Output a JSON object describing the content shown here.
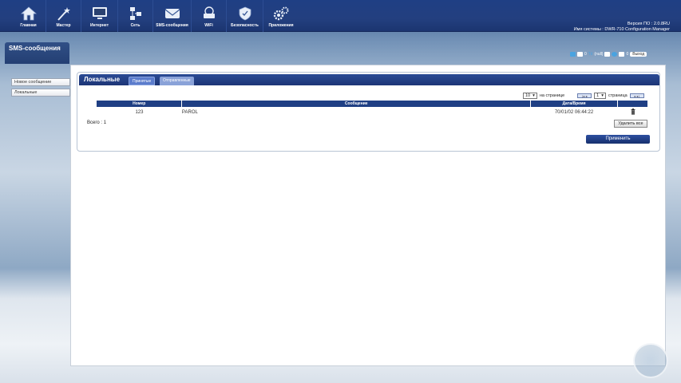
{
  "nav": {
    "items": [
      {
        "label": "Главная",
        "icon": "home-icon"
      },
      {
        "label": "Мастер",
        "icon": "wizard-icon"
      },
      {
        "label": "Интернет",
        "icon": "monitor-icon"
      },
      {
        "label": "Сеть",
        "icon": "network-icon"
      },
      {
        "label": "SMS-сообщения",
        "icon": "envelope-icon"
      },
      {
        "label": "WiFi",
        "icon": "wifi-router-icon"
      },
      {
        "label": "Безопасность",
        "icon": "shield-icon"
      },
      {
        "label": "Приложения",
        "icon": "gears-icon"
      }
    ]
  },
  "system": {
    "firmware": "Версия ПО : 2.0.8RU",
    "name": "Имя системы : DWR-710 Configuration Manager"
  },
  "sidebar": {
    "title": "SMS-сообщения",
    "items": [
      {
        "label": "Новое сообщение"
      },
      {
        "label": "Локальные"
      }
    ]
  },
  "status": {
    "mail_count": "0",
    "signal": "(null)",
    "sms_count": "0",
    "logout": "Выход"
  },
  "panel": {
    "title": "Локальные",
    "tabs": [
      {
        "label": "Принятые",
        "active": true
      },
      {
        "label": "Отправленные",
        "active": false
      }
    ]
  },
  "pager": {
    "per_page_value": "10",
    "per_page_label": "на странице",
    "page_value": "1",
    "page_label": "страница"
  },
  "table": {
    "columns": [
      "Номер",
      "Сообщение",
      "Дата/Время"
    ],
    "rows": [
      {
        "number": "123",
        "message": "PAROL",
        "datetime": "70/01/02 06:44:22"
      }
    ]
  },
  "total": "Всего : 1",
  "buttons": {
    "delete_all": "Удалить все",
    "apply": "Применить"
  },
  "colors": {
    "nav_bg": "#1f3f84",
    "header_bg": "#1d3576",
    "tab_active": "#5b7ccc"
  }
}
